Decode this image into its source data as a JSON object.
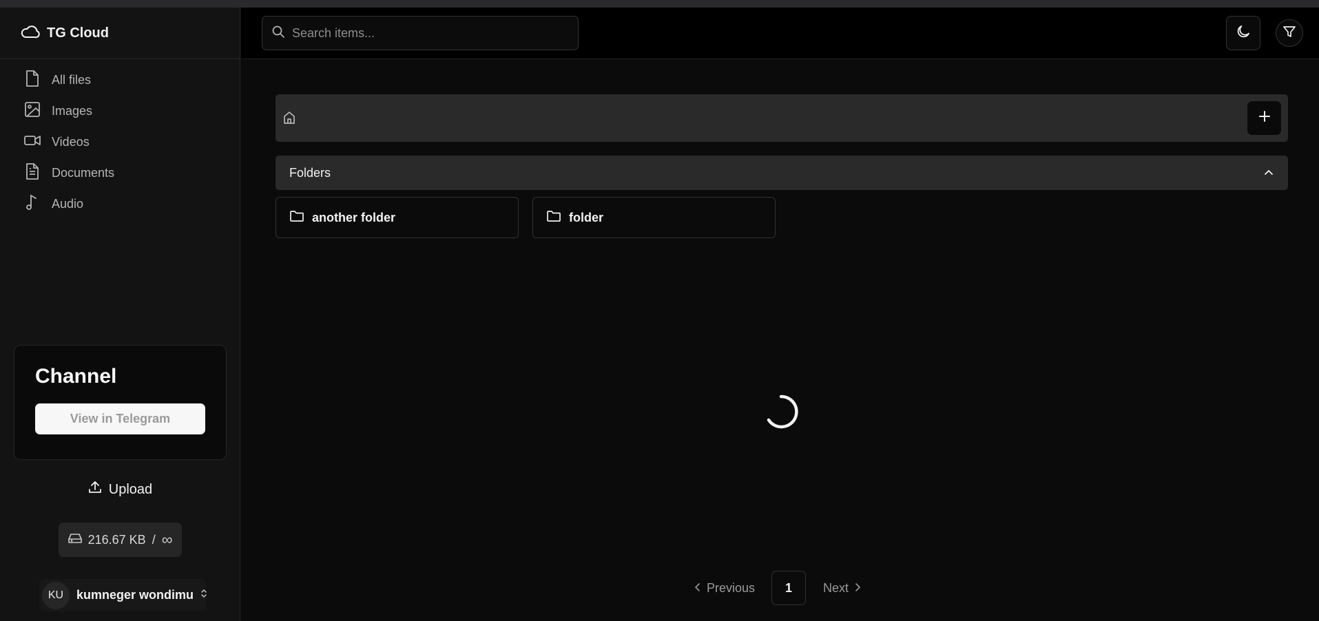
{
  "app": {
    "name": "TG Cloud"
  },
  "sidebar": {
    "items": [
      {
        "label": "All files",
        "icon": "file-icon"
      },
      {
        "label": "Images",
        "icon": "image-icon"
      },
      {
        "label": "Videos",
        "icon": "video-icon"
      },
      {
        "label": "Documents",
        "icon": "document-icon"
      },
      {
        "label": "Audio",
        "icon": "music-note-icon"
      }
    ],
    "channel": {
      "title": "Channel",
      "button_label": "View in Telegram"
    },
    "upload_label": "Upload",
    "storage": {
      "used": "216.67 KB",
      "separator": "/",
      "limit": "∞"
    },
    "user": {
      "initials": "KU",
      "name": "kumneger wondimu"
    }
  },
  "header": {
    "search_placeholder": "Search items...",
    "theme_toggle_icon": "moon-icon",
    "filter_icon": "filter-icon"
  },
  "main": {
    "breadcrumb": {
      "home_icon": "home-icon",
      "add_icon": "plus-icon"
    },
    "folders_section": {
      "label": "Folders",
      "expanded": true,
      "items": [
        {
          "name": "another folder"
        },
        {
          "name": "folder"
        }
      ]
    },
    "loading": true
  },
  "pagination": {
    "previous_label": "Previous",
    "current_page": "1",
    "next_label": "Next"
  }
}
